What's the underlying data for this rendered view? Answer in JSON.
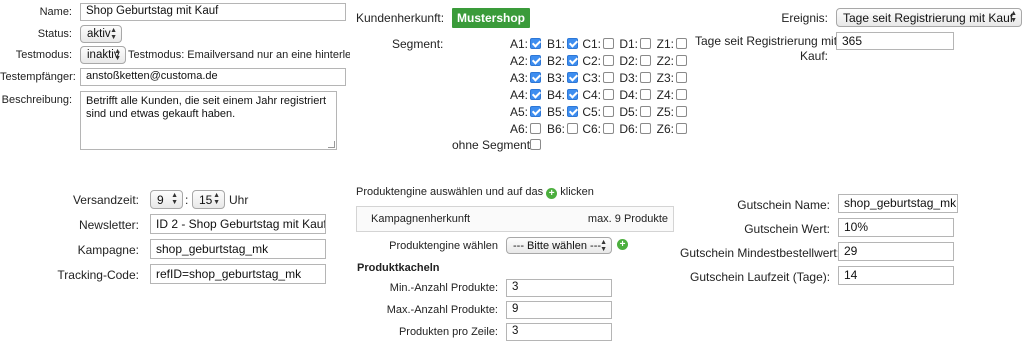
{
  "left_top": {
    "name_label": "Name:",
    "name_value": "Shop Geburtstag mit Kauf",
    "status_label": "Status:",
    "status_value": "aktiv",
    "testmodus_label": "Testmodus:",
    "testmodus_value": "inaktiv",
    "testmodus_hint": "Testmodus: Emailversand nur an eine hinterlegte Ad",
    "testempfaenger_label": "Testempfänger:",
    "testempfaenger_value": "anstoßketten@customa.de",
    "beschreibung_label": "Beschreibung:",
    "beschreibung_value": "Betrifft alle Kunden, die seit einem Jahr registriert sind und etwas gekauft haben."
  },
  "middle_top": {
    "kundenherkunft_label": "Kundenherkunft:",
    "kundenherkunft_value": "Mustershop",
    "segment_label": "Segment:",
    "ohne_segment_label": "ohne Segment:",
    "segments": [
      [
        "A1:",
        "B1:",
        "C1:",
        "D1:",
        "Z1:"
      ],
      [
        "A2:",
        "B2:",
        "C2:",
        "D2:",
        "Z2:"
      ],
      [
        "A3:",
        "B3:",
        "C3:",
        "D3:",
        "Z3:"
      ],
      [
        "A4:",
        "B4:",
        "C4:",
        "D4:",
        "Z4:"
      ],
      [
        "A5:",
        "B5:",
        "C5:",
        "D5:",
        "Z5:"
      ],
      [
        "A6:",
        "B6:",
        "C6:",
        "D6:",
        "Z6:"
      ]
    ]
  },
  "right_top": {
    "ereignis_label": "Ereignis:",
    "ereignis_value": "Tage seit Registrierung mit Kauf",
    "tage_label_line1": "Tage seit Registrierung mit",
    "tage_label_line2": "Kauf:",
    "tage_value": "365"
  },
  "left_bottom": {
    "versandzeit_label": "Versandzeit:",
    "versandzeit_hour": "9",
    "versandzeit_sep": ":",
    "versandzeit_minute": "15",
    "versandzeit_unit": "Uhr",
    "newsletter_label": "Newsletter:",
    "newsletter_value": "ID 2 - Shop Geburtstag mit Kauf",
    "kampagne_label": "Kampagne:",
    "kampagne_value": "shop_geburtstag_mk",
    "tracking_label": "Tracking-Code:",
    "tracking_value": "refID=shop_geburtstag_mk"
  },
  "middle_bottom": {
    "intro_before": "Produktengine auswählen und auf das",
    "intro_after": "klicken",
    "kampagnenherkunft_label": "Kampagnenherkunft",
    "max_produkte": "max. 9 Produkte",
    "engine_label": "Produktengine wählen",
    "engine_value": "--- Bitte wählen ---",
    "kacheln_heading": "Produktkacheln",
    "min_label": "Min.-Anzahl Produkte:",
    "min_value": "3",
    "max_label": "Max.-Anzahl Produkte:",
    "max_value": "9",
    "zeile_label": "Produkten pro Zeile:",
    "zeile_value": "3"
  },
  "right_bottom": {
    "gutschein_name_label": "Gutschein Name:",
    "gutschein_name_value": "shop_geburtstag_mk",
    "gutschein_wert_label": "Gutschein Wert:",
    "gutschein_wert_value": "10%",
    "gutschein_mbw_label": "Gutschein Mindestbestellwert:",
    "gutschein_mbw_value": "29",
    "gutschein_laufzeit_label": "Gutschein Laufzeit (Tage):",
    "gutschein_laufzeit_value": "14"
  },
  "colors": {
    "badge_green": "#3a9b3a",
    "checkbox_blue": "#3e8ef0",
    "plus_green": "#4caf3e"
  }
}
